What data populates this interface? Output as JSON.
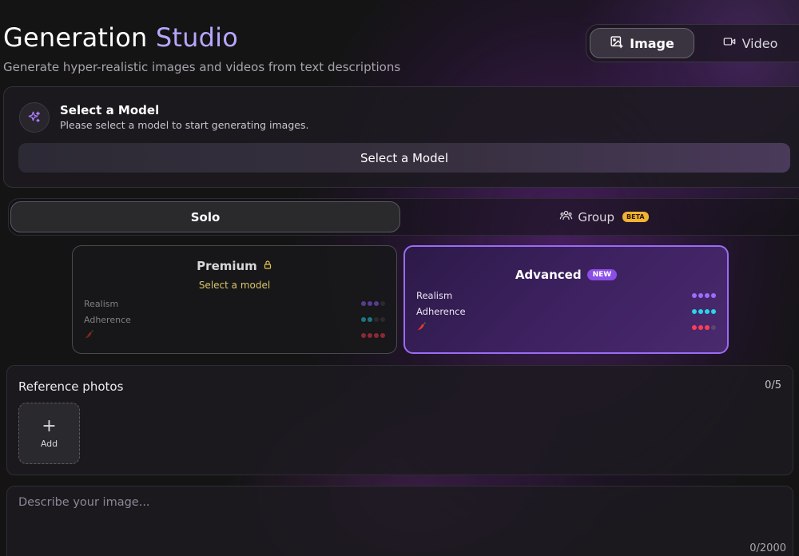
{
  "header": {
    "title_main": "Generation",
    "title_accent": "Studio",
    "subtitle": "Generate hyper-realistic images and videos from text descriptions"
  },
  "mode_switch": {
    "image_label": "Image",
    "video_label": "Video",
    "selected": "Image"
  },
  "model_select": {
    "heading": "Select a Model",
    "description": "Please select a model to start generating images.",
    "button_label": "Select a Model"
  },
  "type_switch": {
    "solo_label": "Solo",
    "group_label": "Group",
    "group_badge": "BETA",
    "selected": "Solo"
  },
  "tiers": {
    "premium": {
      "name": "Premium",
      "subtitle": "Select a model",
      "locked": true,
      "stats": [
        {
          "label": "Realism",
          "level": 3,
          "max": 4,
          "color": "#8a5cf0"
        },
        {
          "label": "Adherence",
          "level": 2,
          "max": 4,
          "color": "#1fc4d8"
        },
        {
          "label": "spice",
          "level": 4,
          "max": 4,
          "color": "#e83b4d"
        }
      ]
    },
    "advanced": {
      "name": "Advanced",
      "badge": "NEW",
      "selected": true,
      "stats": [
        {
          "label": "Realism",
          "level": 4,
          "max": 4,
          "color": "#9f6bff"
        },
        {
          "label": "Adherence",
          "level": 4,
          "max": 4,
          "color": "#26d6ea"
        },
        {
          "label": "spice",
          "level": 3,
          "max": 4,
          "color": "#ff3d55"
        }
      ]
    }
  },
  "reference_photos": {
    "title": "Reference photos",
    "count": "0/5",
    "add_label": "Add"
  },
  "prompt": {
    "placeholder": "Describe your image...",
    "value": "",
    "char_count": "0/2000"
  },
  "colors": {
    "accent": "#b8a6ff",
    "selected_border": "#9a6cf5",
    "premium_subtitle": "#d9c56a",
    "beta_badge": "#f2b233",
    "new_badge": "#8b4ee6"
  }
}
